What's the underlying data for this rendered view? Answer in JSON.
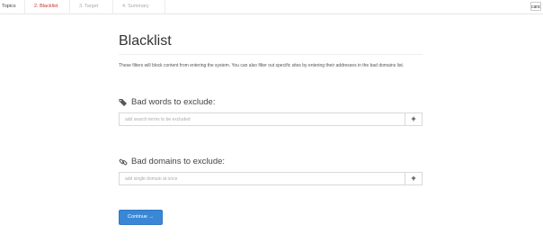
{
  "header": {
    "tabs": [
      {
        "label": "Topics"
      },
      {
        "label": "2. Blacklist"
      },
      {
        "label": "3. Target"
      },
      {
        "label": "4. Summary"
      }
    ],
    "cancel_label": "canc"
  },
  "main": {
    "title": "Blacklist",
    "description": "These filters will block content from entering the system. You can also filter out specific sites by entering their addresses in the bad domains list.",
    "bad_words": {
      "heading": "Bad words to exclude:",
      "placeholder": "add search terms to be excluded",
      "add_label": "+",
      "icon": "tags-icon"
    },
    "bad_domains": {
      "heading": "Bad domains to exclude:",
      "placeholder": "add single domain at once",
      "add_label": "+",
      "icon": "link-icon"
    },
    "continue_label": "Continue →"
  },
  "colors": {
    "active_tab": "#c9302c",
    "primary_button": "#3a87d6"
  }
}
